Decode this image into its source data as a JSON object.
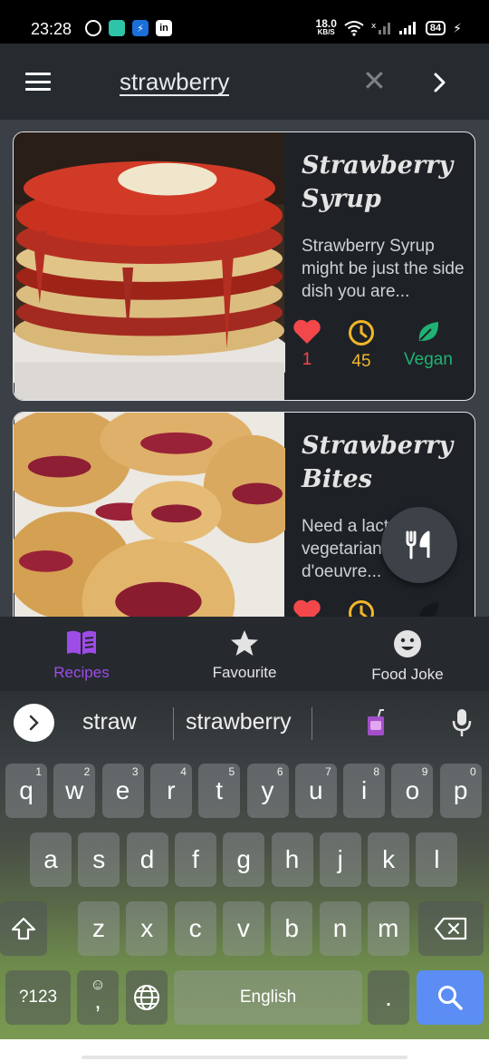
{
  "status_bar": {
    "time": "23:28",
    "net_speed": "18.0",
    "net_unit": "KB/S",
    "battery": "84",
    "apps": [
      "whatsapp-icon",
      "messages-icon",
      "usb-icon",
      "linkedin-icon"
    ],
    "linkedin_glyph": "in"
  },
  "app_bar": {
    "search_query": "strawberry",
    "clear_glyph": "✕"
  },
  "recipes": [
    {
      "title": "Strawberry Syrup",
      "description": "Strawberry Syrup might be just the side dish you are...",
      "likes": "1",
      "minutes": "45",
      "diet": "Vegan"
    },
    {
      "title": "Strawberry Bites",
      "description": "Need a lacto ovo vegetarian hor d'oeuvre...",
      "likes": "",
      "minutes": "",
      "diet": ""
    }
  ],
  "bottom_nav": {
    "items": [
      {
        "label": "Recipes",
        "icon": "book-icon",
        "active": true
      },
      {
        "label": "Favourite",
        "icon": "star-icon",
        "active": false
      },
      {
        "label": "Food Joke",
        "icon": "smile-icon",
        "active": false
      }
    ]
  },
  "keyboard": {
    "suggestions": [
      "straw",
      "strawberry"
    ],
    "row1": [
      {
        "k": "q",
        "h": "1"
      },
      {
        "k": "w",
        "h": "2"
      },
      {
        "k": "e",
        "h": "3"
      },
      {
        "k": "r",
        "h": "4"
      },
      {
        "k": "t",
        "h": "5"
      },
      {
        "k": "y",
        "h": "6"
      },
      {
        "k": "u",
        "h": "7"
      },
      {
        "k": "i",
        "h": "8"
      },
      {
        "k": "o",
        "h": "9"
      },
      {
        "k": "p",
        "h": "0"
      }
    ],
    "row2": [
      "a",
      "s",
      "d",
      "f",
      "g",
      "h",
      "j",
      "k",
      "l"
    ],
    "row3": [
      "z",
      "x",
      "c",
      "v",
      "b",
      "n",
      "m"
    ],
    "symbols_label": "?123",
    "comma_label": ",",
    "space_label": "English",
    "period_label": "."
  },
  "colors": {
    "accent": "#9d4ce6",
    "like": "#f2484b",
    "time": "#f3b62a",
    "vegan": "#1fb273",
    "search_key": "#5b8df5"
  }
}
